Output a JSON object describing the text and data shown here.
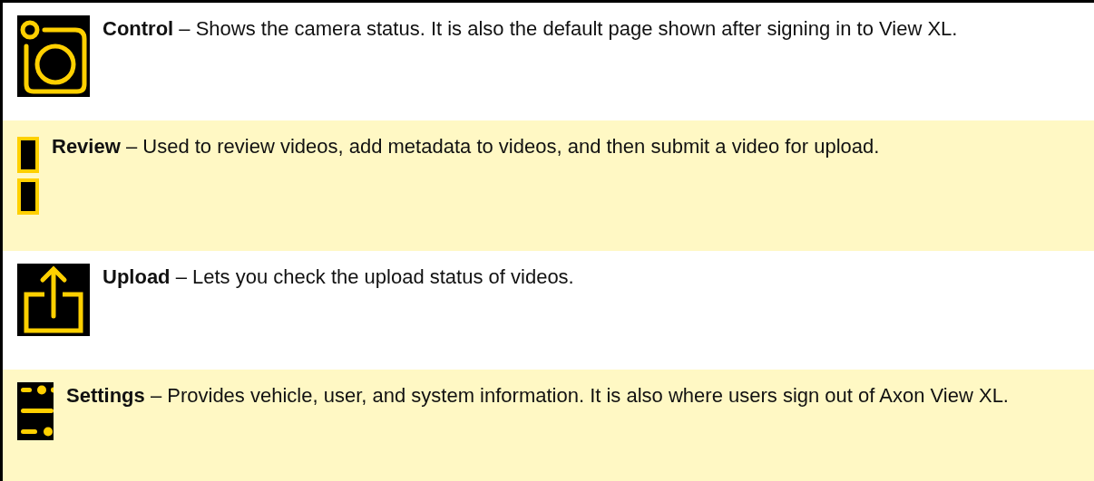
{
  "rows": [
    {
      "kind": "camera",
      "term": "Control",
      "text": " – Shows the camera status. It is also the default page shown after signing in to View XL.",
      "highlighted": false
    },
    {
      "kind": "review",
      "term": "Review",
      "text": " – Used to review videos, add metadata to videos, and then submit a video for upload.",
      "highlighted": true
    },
    {
      "kind": "upload",
      "term": "Upload",
      "text": " – Lets you check the upload status of videos.",
      "highlighted": false
    },
    {
      "kind": "settings",
      "term": "Settings",
      "text": " – Provides vehicle, user, and system information. It is also where users sign out of Axon View XL.",
      "highlighted": true
    }
  ]
}
